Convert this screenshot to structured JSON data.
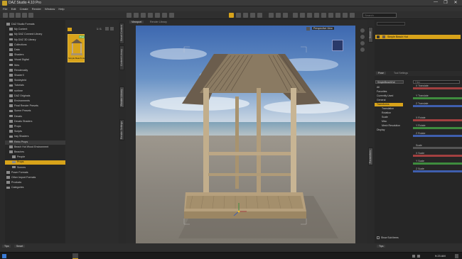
{
  "window": {
    "title": "DAZ Studio 4.10 Pro",
    "controls": [
      "—",
      "❐",
      "✕"
    ]
  },
  "menu": [
    "File",
    "Edit",
    "Create",
    "Render",
    "Window",
    "Help"
  ],
  "toolbar": {
    "search_placeholder": "Search",
    "icon_names": [
      "new-icon",
      "open-icon",
      "save-icon",
      "undo-icon",
      "redo-icon",
      "pose-tool-icon",
      "node-select-icon",
      "move-tool-icon",
      "rotate-tool-icon",
      "scale-tool-icon",
      "transform-tool-icon",
      "render-icon",
      "spot-render-icon",
      "camera-icon",
      "light-icon",
      "figure-icon",
      "primitive-icon",
      "settings-icon",
      "help-icon"
    ]
  },
  "left_tabs": [
    "Smart Content",
    "Content Library",
    "Render Library",
    "Render Settings"
  ],
  "content_library": {
    "header": "DAZ Studio Formats",
    "items": [
      {
        "label": "DAZ Studio Formats",
        "indent": 0
      },
      {
        "label": "My Content",
        "indent": 1
      },
      {
        "label": "My DAZ Connect Library",
        "indent": 1
      },
      {
        "label": "My DAZ 3D Library",
        "indent": 1
      },
      {
        "label": "Collections",
        "indent": 1
      },
      {
        "label": "Data",
        "indent": 1
      },
      {
        "label": "Shaders",
        "indent": 1
      },
      {
        "label": "Visual Digital",
        "indent": 1
      },
      {
        "label": "Wes",
        "indent": 1
      },
      {
        "label": "Renderosity",
        "indent": 1
      },
      {
        "label": "ShaderX",
        "indent": 1
      },
      {
        "label": "Sickleyield",
        "indent": 1
      },
      {
        "label": "Tutorials",
        "indent": 1
      },
      {
        "label": "runtime",
        "indent": 1
      },
      {
        "label": "DAZ Originals",
        "indent": 1
      },
      {
        "label": "Environments",
        "indent": 1
      },
      {
        "label": "Final Render Presets",
        "indent": 1
      },
      {
        "label": "Scene Presets",
        "indent": 1
      },
      {
        "label": "Decals",
        "indent": 1
      },
      {
        "label": "Decals Shaders",
        "indent": 1
      },
      {
        "label": "Props",
        "indent": 1
      },
      {
        "label": "Scripts",
        "indent": 1
      },
      {
        "label": "Iray Shaders",
        "indent": 1
      },
      {
        "label": "Retro Props",
        "indent": 1
      },
      {
        "label": "Beach Hut Wood Environment",
        "indent": 1
      },
      {
        "label": "Beaches",
        "indent": 1
      },
      {
        "label": "People",
        "indent": 2
      },
      {
        "label": "Props",
        "indent": 2,
        "selected": true
      },
      {
        "label": "Scenes",
        "indent": 2
      },
      {
        "label": "Poser Formats",
        "indent": 0
      },
      {
        "label": "Other Import Formats",
        "indent": 0
      },
      {
        "label": "Products",
        "indent": 0
      },
      {
        "label": "Categories",
        "indent": 0
      }
    ],
    "page_label": "1 / 1",
    "thumbnail": {
      "badge": "Prop",
      "caption": "Simple Beach Hut"
    }
  },
  "viewport_tabs": [
    "Viewport",
    "Render Library"
  ],
  "viewport": {
    "camera_label": "Perspective View"
  },
  "right_tabs_top": [
    "Scene",
    "Parameters"
  ],
  "scene": {
    "node": "Simple Beach Hut"
  },
  "parameters": {
    "tabs": [
      "Pose",
      "Tool Settings"
    ],
    "node_label": "SimpleBeachHut",
    "filter_placeholder": "Filter",
    "categories": [
      {
        "label": "All",
        "selected": false
      },
      {
        "label": "Favorites",
        "selected": false
      },
      {
        "label": "Currently Used",
        "selected": false
      },
      {
        "label": "General",
        "selected": false
      },
      {
        "label": "Transforms",
        "selected": true
      },
      {
        "label": "Translation",
        "selected": false
      },
      {
        "label": "Rotation",
        "selected": false
      },
      {
        "label": "Scale",
        "selected": false
      },
      {
        "label": "Misc",
        "selected": false
      },
      {
        "label": "Mesh Resolution",
        "selected": false
      },
      {
        "label": "Display",
        "selected": false
      }
    ],
    "rows": [
      {
        "label": "X Translate",
        "value": "0.0",
        "axis": "x"
      },
      {
        "label": "Y Translate",
        "value": "0.0",
        "axis": "y"
      },
      {
        "label": "Z Translate",
        "value": "0.0",
        "axis": "z"
      },
      {
        "label": "X Rotate",
        "value": "0.00",
        "axis": "x"
      },
      {
        "label": "Y Rotate",
        "value": "0.00",
        "axis": "y"
      },
      {
        "label": "Z Rotate",
        "value": "0.00",
        "axis": "z"
      },
      {
        "label": "Scale",
        "value": "100%",
        "axis": ""
      },
      {
        "label": "X Scale",
        "value": "100%",
        "axis": "x"
      },
      {
        "label": "Y Scale",
        "value": "100%",
        "axis": "y"
      },
      {
        "label": "Z Scale",
        "value": "100%",
        "axis": "z"
      }
    ],
    "footer_checkbox": "Show Sub Items"
  },
  "bottom_tabs_left": [
    "Tips",
    "Smart"
  ],
  "bottom_tabs_right": [
    "Tips"
  ],
  "taskbar": {
    "time": "9:23 AM"
  },
  "colors": {
    "accent": "#d8a31a",
    "panel": "#262626",
    "x_axis": "#a24040",
    "y_axis": "#3e8c3e",
    "z_axis": "#3f5fae"
  }
}
